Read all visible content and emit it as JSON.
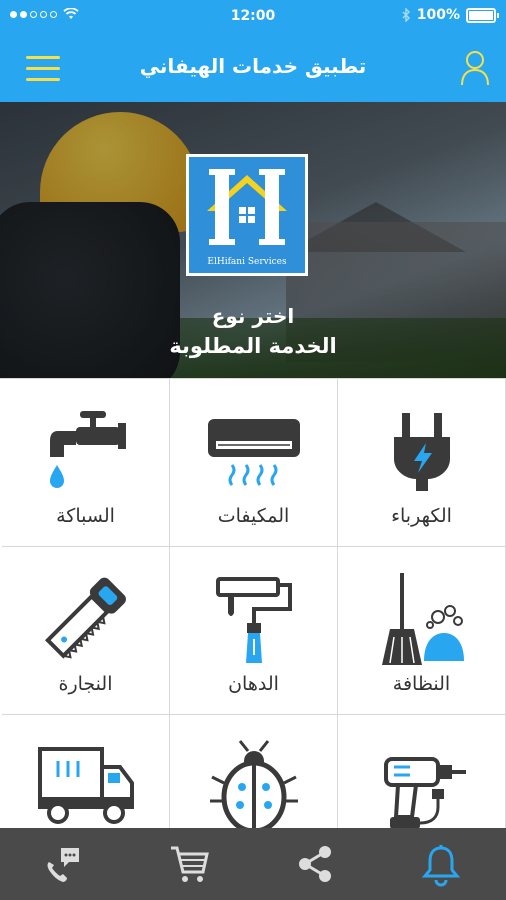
{
  "status": {
    "time": "12:00",
    "battery": "100%",
    "signal_dots": 5
  },
  "header": {
    "title": "تطبيق خدمات الهيفاني",
    "menu_icon": "hamburger-menu-icon",
    "profile_icon": "user-profile-icon"
  },
  "banner": {
    "logo_caption": "ElHifani Services",
    "line1": "اختر نوع",
    "line2": "الخدمة المطلوبة"
  },
  "services": [
    {
      "label": "الكهرباء",
      "icon": "electric-plug-icon"
    },
    {
      "label": "المكيفات",
      "icon": "air-conditioner-icon"
    },
    {
      "label": "السباكة",
      "icon": "water-tap-icon"
    },
    {
      "label": "النظافة",
      "icon": "cleaning-broom-icon"
    },
    {
      "label": "الدهان",
      "icon": "paint-roller-icon"
    },
    {
      "label": "النجارة",
      "icon": "hand-saw-icon"
    },
    {
      "label": "",
      "icon": "power-drill-icon"
    },
    {
      "label": "",
      "icon": "ladybug-pest-icon"
    },
    {
      "label": "",
      "icon": "moving-truck-icon"
    }
  ],
  "bottom_nav": [
    {
      "icon": "phone-chat-icon"
    },
    {
      "icon": "shopping-cart-icon"
    },
    {
      "icon": "share-icon"
    },
    {
      "icon": "bell-icon",
      "active": true
    }
  ],
  "colors": {
    "primary": "#29a6f0",
    "accent_yellow": "#f5e04c",
    "icon_blue": "#29a6f0",
    "icon_dark": "#3a3a3a",
    "nav_bg": "#4a4a4a"
  }
}
